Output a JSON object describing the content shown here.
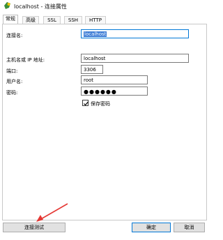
{
  "window": {
    "title": "localhost - 连接属性",
    "icon": "connection-app-icon"
  },
  "tabs": [
    {
      "label": "常规",
      "active": true
    },
    {
      "label": "高级",
      "active": false
    },
    {
      "label": "SSL",
      "active": false
    },
    {
      "label": "SSH",
      "active": false
    },
    {
      "label": "HTTP",
      "active": false
    }
  ],
  "form": {
    "connection_name": {
      "label": "连接名:",
      "value": "localhost"
    },
    "host": {
      "label": "主机名或 IP 地址:",
      "value": "localhost"
    },
    "port": {
      "label": "端口:",
      "value": "3306"
    },
    "username": {
      "label": "用户名:",
      "value": "root"
    },
    "password": {
      "label": "密码:",
      "value": "●●●●●●"
    },
    "save_password": {
      "label": "保存密码",
      "checked": true
    }
  },
  "footer": {
    "test_connection_label": "连接测试",
    "ok_label": "确定",
    "cancel_label": "取消"
  },
  "colors": {
    "annotation_arrow": "#e53935",
    "selection": "#3a7bd5",
    "primary_border": "#0078d7"
  }
}
